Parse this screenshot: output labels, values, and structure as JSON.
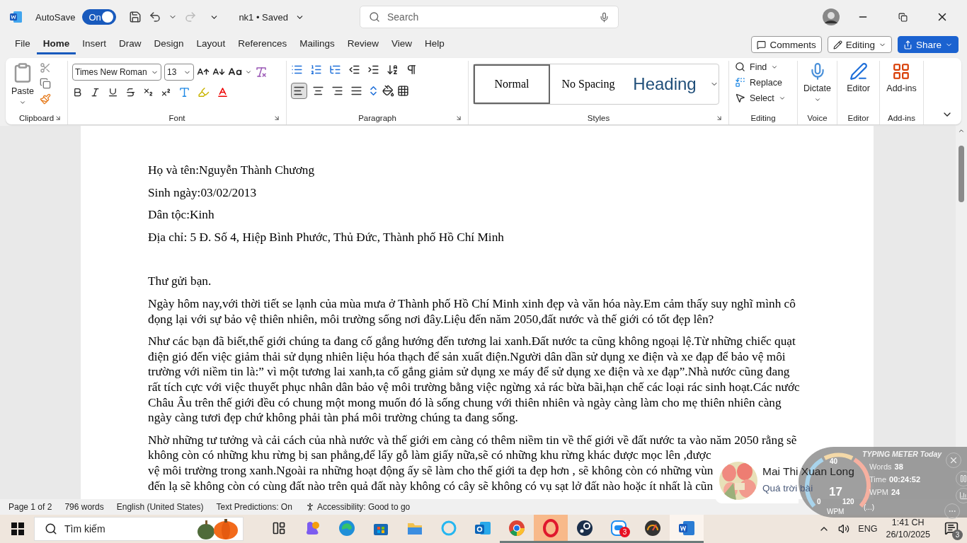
{
  "title_bar": {
    "autosave_label": "AutoSave",
    "autosave": {
      "on": true,
      "label": "On"
    },
    "document_title": "nk1 • Saved",
    "search_placeholder": "Search"
  },
  "tabs": [
    {
      "label": "File",
      "selected": false
    },
    {
      "label": "Home",
      "selected": true
    },
    {
      "label": "Insert",
      "selected": false
    },
    {
      "label": "Draw",
      "selected": false
    },
    {
      "label": "Design",
      "selected": false
    },
    {
      "label": "Layout",
      "selected": false
    },
    {
      "label": "References",
      "selected": false
    },
    {
      "label": "Mailings",
      "selected": false
    },
    {
      "label": "Review",
      "selected": false
    },
    {
      "label": "View",
      "selected": false
    },
    {
      "label": "Help",
      "selected": false
    }
  ],
  "actions": {
    "comments": "Comments",
    "editing": "Editing",
    "share": "Share"
  },
  "ribbon": {
    "paste": "Paste",
    "font_name": "Times New Roman",
    "font_size": "13",
    "alignments": [
      {
        "kind": "left",
        "selected": true
      },
      {
        "kind": "center",
        "selected": false
      },
      {
        "kind": "right",
        "selected": false
      },
      {
        "kind": "justify",
        "selected": false
      }
    ],
    "styles": [
      {
        "label": "Normal",
        "kind": "normal",
        "selected": true
      },
      {
        "label": "No Spacing",
        "kind": "normal",
        "selected": false
      },
      {
        "label": "Heading",
        "kind": "heading",
        "selected": false
      }
    ],
    "editing": [
      "Find",
      "Replace",
      "Select"
    ],
    "dictate": "Dictate",
    "editor": "Editor",
    "addins": "Add-ins",
    "groups": [
      "Clipboard",
      "Font",
      "Paragraph",
      "Styles",
      "Editing",
      "Voice",
      "Editor",
      "Add-ins"
    ]
  },
  "document": {
    "header_lines": [
      "Họ và tên:Nguyễn Thành Chương",
      "Sinh ngày:03/02/2013",
      "Dân tộc:Kinh",
      "Địa chỉ: 5 Đ. Số 4, Hiệp Bình Phước, Thủ Đức, Thành phố Hồ Chí Minh"
    ],
    "paragraphs": [
      "Thư gửi bạn.",
      "Ngày hôm nay,với thời tiết se lạnh của mùa mưa ở Thành phố Hồ Chí Minh xinh đẹp và văn hóa này.Em cảm thấy suy nghĩ mình cô đọng lại với sự bảo vệ thiên nhiên, môi trường sống nơi đây.Liệu đến năm 2050,đất nước và thế giới có tốt đẹp lên?",
      "Như các bạn đã biết,thế giới chúng ta đang cố gắng hướng đến tương lai xanh.Đất nước ta cũng không ngoại lệ.Từ những chiếc quạt điện gió đến việc giảm thải sử dụng nhiên liệu hóa thạch để sản xuất điện.Người dân dần sử dụng xe điện và xe đạp để bảo vệ môi trường với niềm tin là:” vì một tương lai xanh,ta cố gắng giảm sử dụng xe máy để sử dụng xe điện và xe đạp”.Nhà nước cũng đang rất tích cực với việc thuyết phục nhân dân bảo vệ môi trường bằng việc ngừng xả rác bừa bãi,hạn chế các loại rác sinh hoạt.Các nước Châu Âu trên thế giới đều có chung một mong muốn đó là sống chung với thiên nhiên và ngày càng làm cho mẹ thiên nhiên càng ngày càng tươi đẹp chứ không phải tàn phá môi trường chúng ta đang sống."
    ],
    "last_paragraph_lines": [
      "Nhờ những tư tưởng và cải cách của nhà nước và thế giới em càng có thêm niềm tin về thế giới về đất nước ta vào năm 2050 rằng sẽ",
      "không còn có những khu rừng bị san phẳng,để lấy gỗ làm giấy nữa,sẽ có những khu rừng khác được mọc lên ,được",
      "vệ môi trường trong xanh.Ngoài ra những hoạt động ấy sẽ làm cho thế giới ta đẹp hơn , sẽ không còn có những vùn",
      "đến lạ sẽ không còn có cùng đất nào trên quả đất này không có cây sẽ không có vụ sạt lở đất nào hoặc ít nhất là cũn"
    ]
  },
  "status_bar": [
    "Page 1 of 2",
    "796 words",
    "English (United States)",
    "Text Predictions: On",
    "Accessibility: Good to go"
  ],
  "notification": {
    "name": "Mai Thi Xuan Long",
    "message": "Quá trời bài"
  },
  "typing_meter": {
    "title": "TYPING METER Today",
    "ticks": [
      "0",
      "40",
      "120"
    ],
    "value": "17",
    "unit": "WPM",
    "stats": [
      {
        "label": "Words",
        "value": "38"
      },
      {
        "label": "Time",
        "value": "00:24:52"
      },
      {
        "label": "WPM",
        "value": "24"
      }
    ],
    "search": "(...)"
  },
  "taskbar": {
    "search_placeholder": "Tìm kiếm",
    "apps": [
      {
        "kind": "taskview",
        "running": false,
        "highlighted": false
      },
      {
        "kind": "copilot",
        "running": false,
        "highlighted": false
      },
      {
        "kind": "edge",
        "running": false,
        "highlighted": false
      },
      {
        "kind": "store",
        "running": false,
        "highlighted": false
      },
      {
        "kind": "folder",
        "running": false,
        "highlighted": false
      },
      {
        "kind": "ring",
        "running": false,
        "highlighted": false
      },
      {
        "kind": "outlook",
        "running": false,
        "highlighted": false
      },
      {
        "kind": "chrome",
        "running": true,
        "highlighted": false
      },
      {
        "kind": "opera",
        "running": true,
        "highlighted": true
      },
      {
        "kind": "steam",
        "running": true,
        "highlighted": false
      },
      {
        "kind": "zalo",
        "running": true,
        "highlighted": false,
        "badge": "3"
      },
      {
        "kind": "meter",
        "running": true,
        "highlighted": false
      },
      {
        "kind": "word",
        "running": true,
        "highlighted": true
      }
    ],
    "language": "ENG",
    "time": "1:41 CH",
    "date": "26/10/2025",
    "notification_count": "3"
  }
}
